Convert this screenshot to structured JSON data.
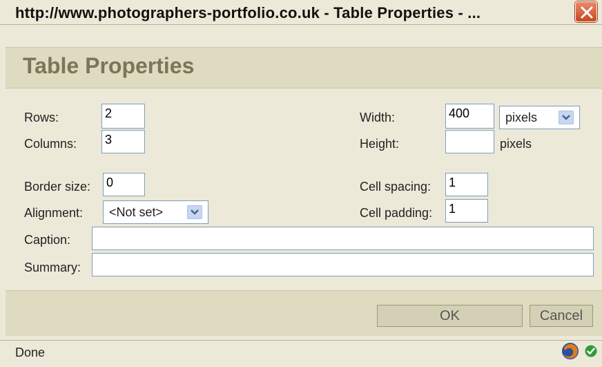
{
  "window": {
    "title": "http://www.photographers-portfolio.co.uk - Table Properties - ..."
  },
  "dialog": {
    "heading": "Table Properties"
  },
  "form": {
    "rows_label": "Rows:",
    "rows_value": "2",
    "columns_label": "Columns:",
    "columns_value": "3",
    "width_label": "Width:",
    "width_value": "400",
    "width_unit": "pixels",
    "height_label": "Height:",
    "height_value": "",
    "height_unit": "pixels",
    "border_label": "Border size:",
    "border_value": "0",
    "alignment_label": "Alignment:",
    "alignment_value": "<Not set>",
    "cellspacing_label": "Cell spacing:",
    "cellspacing_value": "1",
    "cellpadding_label": "Cell padding:",
    "cellpadding_value": "1",
    "caption_label": "Caption:",
    "caption_value": "",
    "summary_label": "Summary:",
    "summary_value": ""
  },
  "buttons": {
    "ok": "OK",
    "cancel": "Cancel"
  },
  "status": {
    "text": "Done"
  },
  "colors": {
    "dialog_bg": "#ece9d8",
    "band_bg": "#dedbc1",
    "heading": "#7a7659",
    "close_red": "#c9471f"
  },
  "icons": [
    "close-icon",
    "chevron-down-icon",
    "firefox-icon",
    "check-icon"
  ]
}
